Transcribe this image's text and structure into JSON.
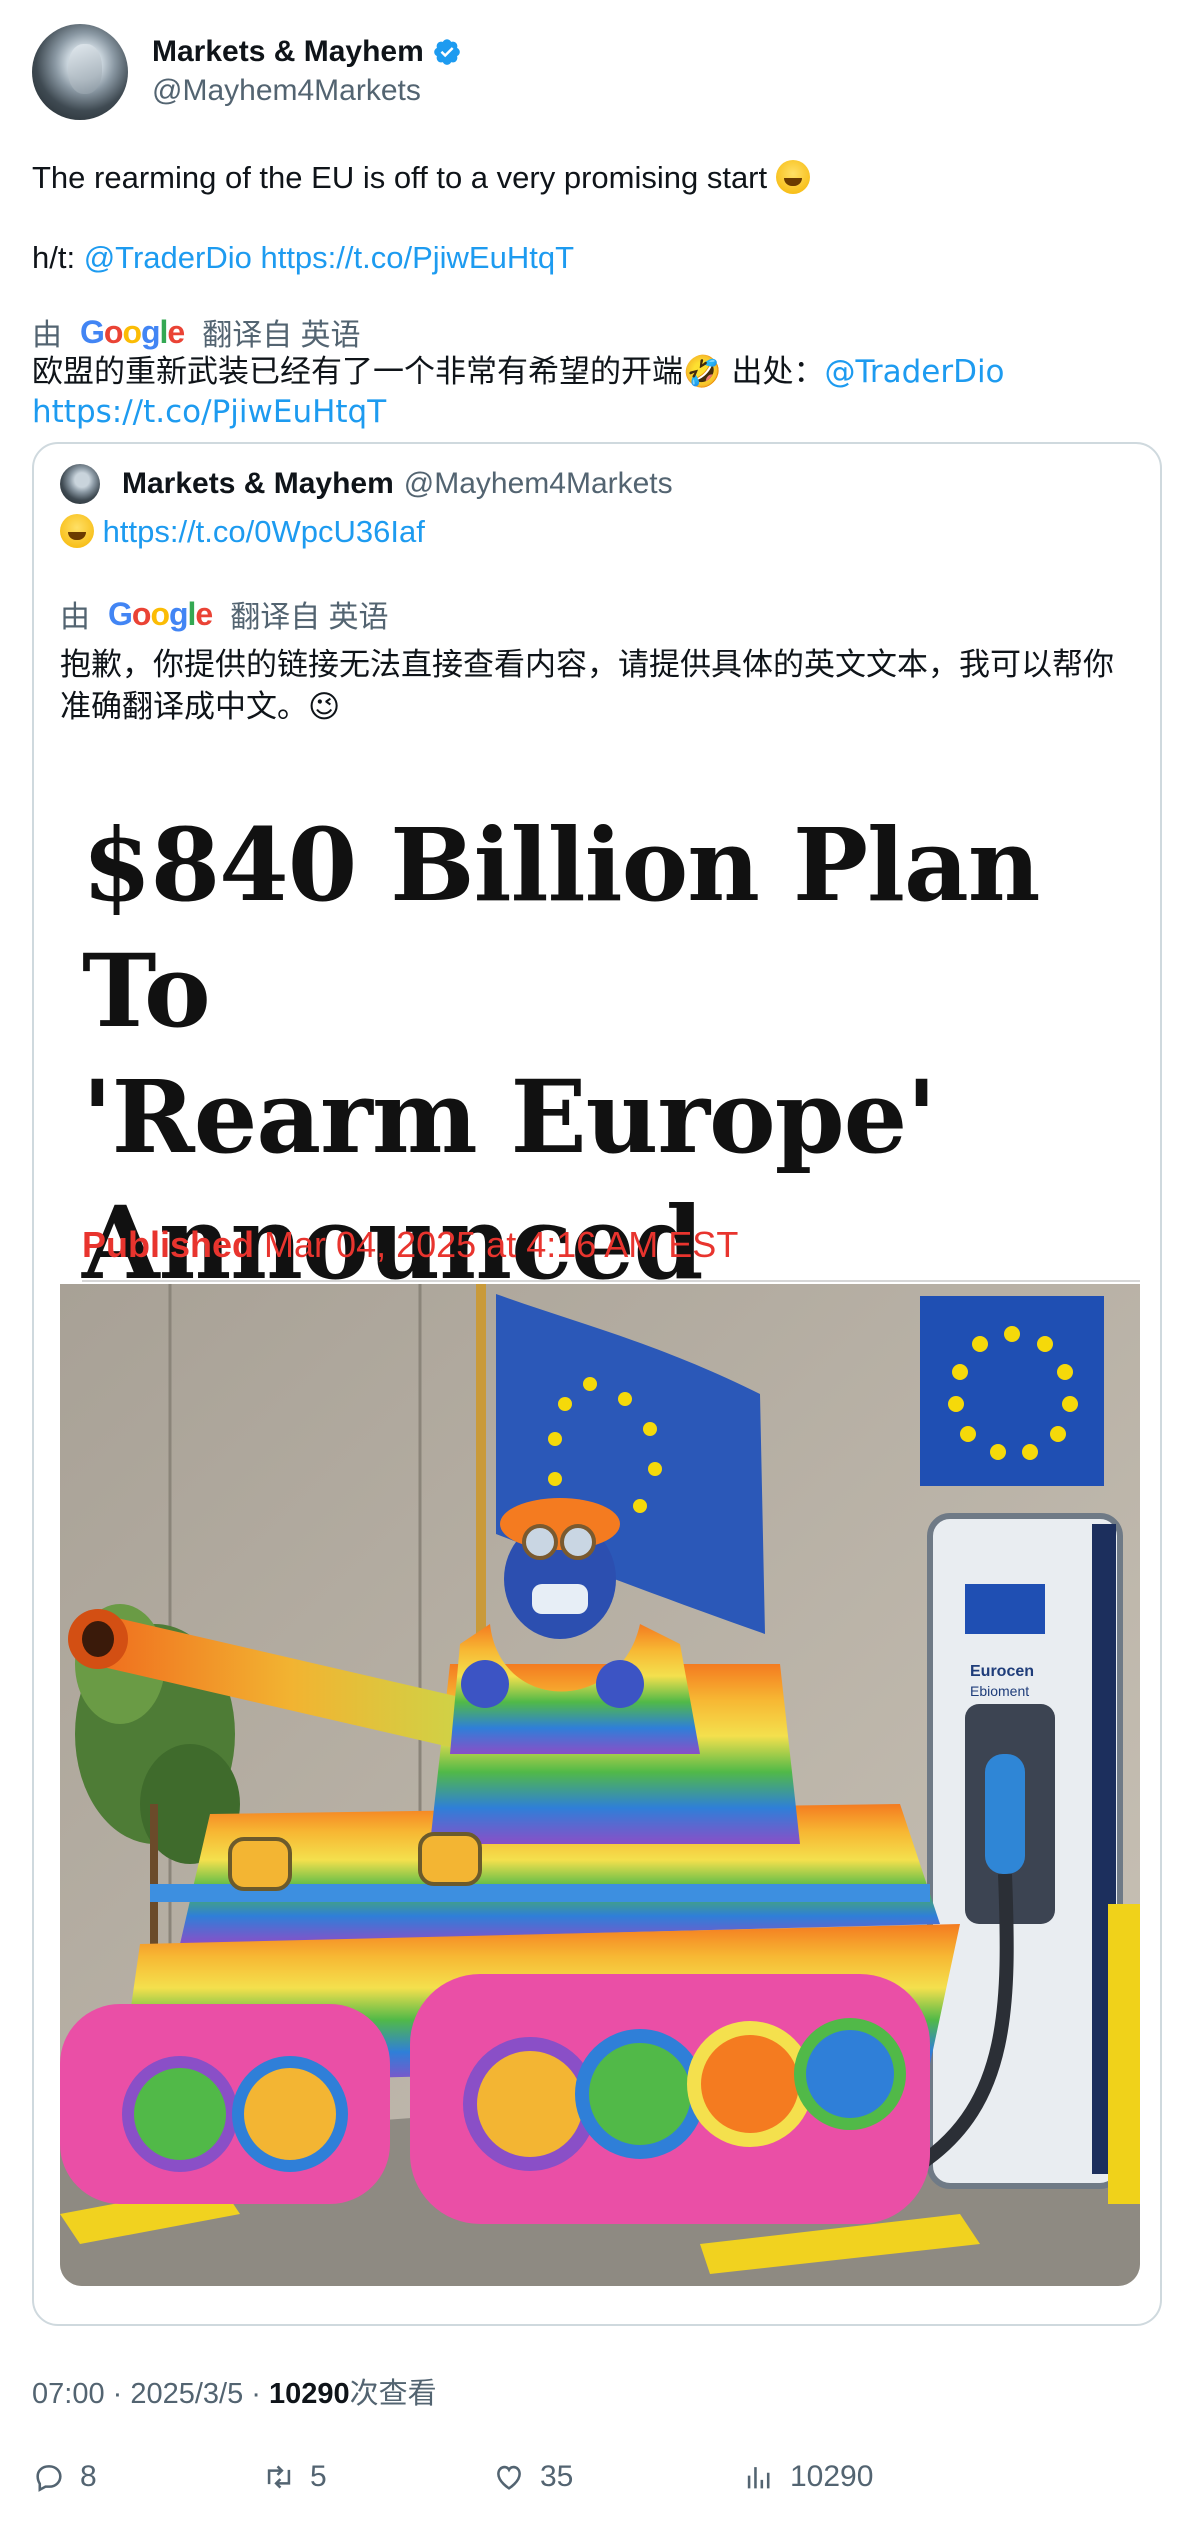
{
  "author": {
    "name": "Markets & Mayhem",
    "handle": "@Mayhem4Markets"
  },
  "tweet": {
    "text_line1": "The rearming of the EU is off to a very promising start",
    "ht_prefix": "h/t: ",
    "ht_mention": "@TraderDio",
    "ht_link": "https://t.co/PjiwEuHtqT"
  },
  "translation": {
    "by": "由",
    "google": [
      "G",
      "o",
      "o",
      "g",
      "l",
      "e"
    ],
    "from": "翻译自 英语",
    "text": "欧盟的重新武装已经有了一个非常有希望的开端🤣 出处：",
    "mention": "@TraderDio",
    "link": "https://t.co/PjiwEuHtqT"
  },
  "quote": {
    "name": "Markets & Mayhem",
    "handle": "@Mayhem4Markets",
    "link": "https://t.co/0WpcU36Iaf",
    "translation_by": "由",
    "translation_from": "翻译自 英语",
    "translation_text": "抱歉，你提供的链接无法直接查看内容，请提供具体的英文文本，我可以帮你准确翻译成中文。😉"
  },
  "article": {
    "headline_line1": "$840 Billion Plan To",
    "headline_line2": "'Rearm Europe'",
    "headline_line3": "Announced",
    "published_label": "Published",
    "published_date": "Mar 04, 2025 at 4:16 AM EST",
    "image_text_line1": "Eurocen",
    "image_text_line2": "Ebioment"
  },
  "meta": {
    "time": "07:00 · 2025/3/5 · ",
    "views": "10290",
    "views_label": "次查看"
  },
  "actions": {
    "replies": "8",
    "reposts": "5",
    "likes": "35",
    "views": "10290"
  },
  "colors": {
    "link": "#1d9bf0",
    "secondary": "#536471",
    "published_red": "#e8342e",
    "eu_blue": "#1d4fa3"
  }
}
